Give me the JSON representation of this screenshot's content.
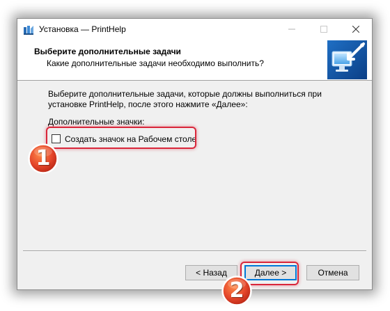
{
  "window": {
    "title": "Установка — PrintHelp"
  },
  "header": {
    "title": "Выберите дополнительные задачи",
    "subtitle": "Какие дополнительные задачи необходимо выполнить?"
  },
  "content": {
    "instruction_line1": "Выберите дополнительные задачи, которые должны выполниться при",
    "instruction_line2": "установке PrintHelp, после этого нажмите «Далее»:",
    "group_label": "Дополнительные значки:",
    "checkbox_label": "Создать значок на Рабочем столе",
    "checkbox_checked": false
  },
  "buttons": {
    "back_label": "< Назад",
    "next_label": "Далее >",
    "cancel_label": "Отмена"
  },
  "annotations": {
    "badge_1": "1",
    "badge_2": "2",
    "highlight_color": "#d9263a"
  },
  "icons": {
    "app": "installer-icon",
    "header_image": "computer-arrow-icon"
  }
}
